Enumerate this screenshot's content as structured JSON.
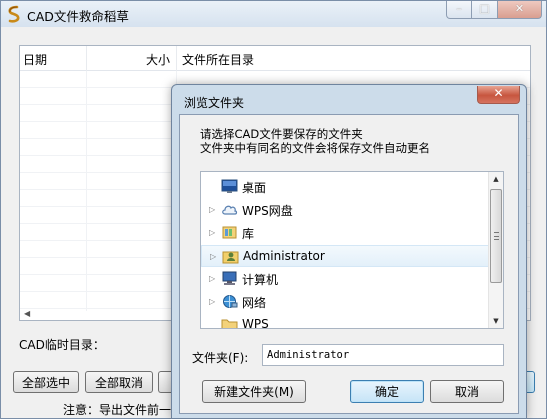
{
  "main": {
    "title": "CAD文件救命稻草",
    "columns": {
      "date": "日期",
      "size": "大小",
      "directory": "文件所在目录"
    },
    "temp_dir_label": "CAD临时目录：",
    "buttons": {
      "select_all": "全部选中",
      "cancel_all": "全部取消"
    },
    "notice": "注意：导出文件前一点"
  },
  "dialog": {
    "title": "浏览文件夹",
    "close_glyph": "✕",
    "instruction_line1": "请选择CAD文件要保存的文件夹",
    "instruction_line2": "文件夹中有同名的文件会将保存文件自动更名",
    "tree": [
      {
        "label": "桌面",
        "icon": "desktop-icon",
        "has_arrow": false
      },
      {
        "label": "WPS网盘",
        "icon": "cloud-icon",
        "has_arrow": true
      },
      {
        "label": "库",
        "icon": "library-icon",
        "has_arrow": true
      },
      {
        "label": "Administrator",
        "icon": "user-folder-icon",
        "has_arrow": true,
        "selected": true
      },
      {
        "label": "计算机",
        "icon": "computer-icon",
        "has_arrow": true
      },
      {
        "label": "网络",
        "icon": "network-icon",
        "has_arrow": true
      },
      {
        "label": "WPS",
        "icon": "folder-icon",
        "has_arrow": false
      }
    ],
    "folder_label": "文件夹(F):",
    "folder_value": "Administrator",
    "buttons": {
      "new_folder": "新建文件夹(M)",
      "ok": "确定",
      "cancel": "取消"
    }
  }
}
